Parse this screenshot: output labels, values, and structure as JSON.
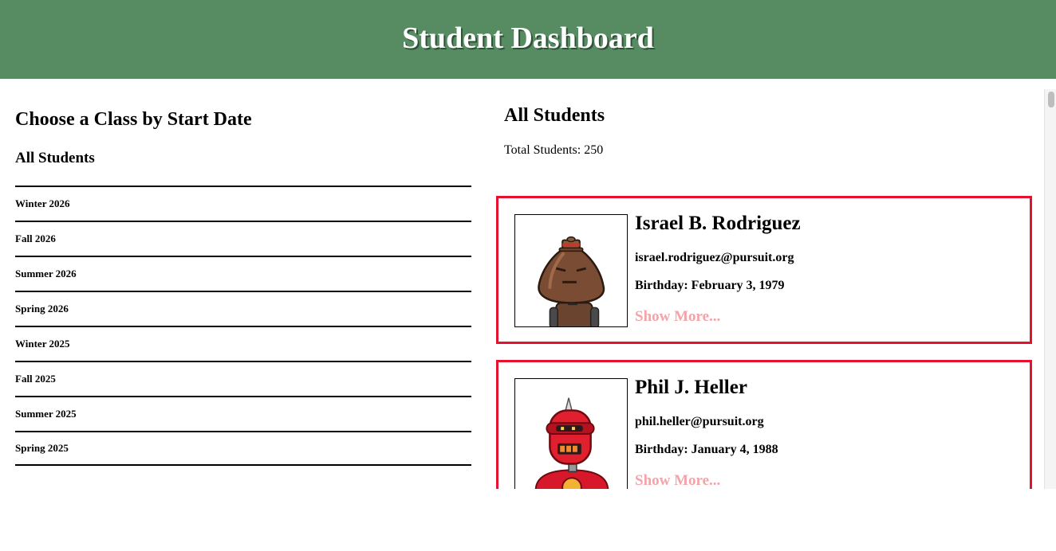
{
  "header": {
    "title": "Student Dashboard"
  },
  "colors": {
    "header_bg": "#578b62",
    "card_border": "#e8112d",
    "link": "#f4a3a8"
  },
  "sidebar": {
    "heading": "Choose a Class by Start Date",
    "all_students_label": "All Students",
    "classes": [
      "Winter 2026",
      "Fall 2026",
      "Summer 2026",
      "Spring 2026",
      "Winter 2025",
      "Fall 2025",
      "Summer 2025",
      "Spring 2025"
    ]
  },
  "main": {
    "heading": "All Students",
    "total_label": "Total Students: 250",
    "students": [
      {
        "name": "Israel B. Rodriguez",
        "email": "israel.rodriguez@pursuit.org",
        "birthday": "Birthday: February 3, 1979",
        "more_label": "Show More...",
        "avatar_icon": "brown-robot-avatar-icon"
      },
      {
        "name": "Phil J. Heller",
        "email": "phil.heller@pursuit.org",
        "birthday": "Birthday: January 4, 1988",
        "more_label": "Show More...",
        "avatar_icon": "red-robot-avatar-icon"
      }
    ]
  }
}
